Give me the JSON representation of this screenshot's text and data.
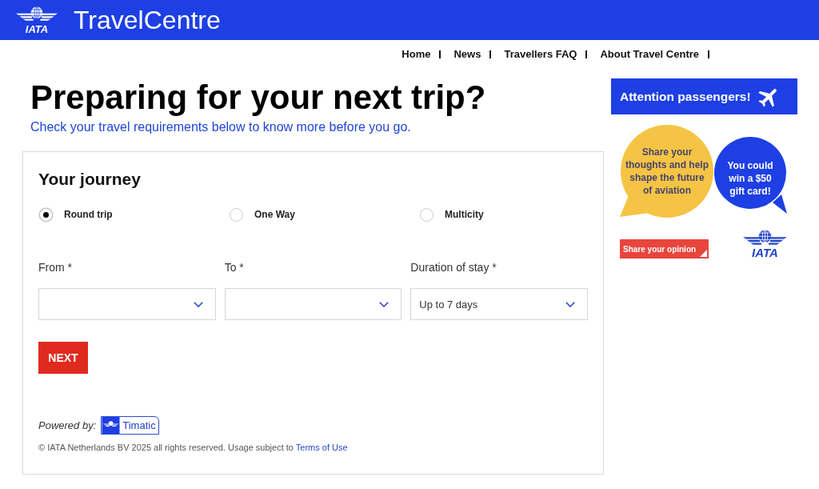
{
  "header": {
    "logo_text": "IATA",
    "title": "TravelCentre"
  },
  "nav": [
    {
      "label": "Home"
    },
    {
      "label": "News"
    },
    {
      "label": "Travellers FAQ"
    },
    {
      "label": "About Travel Centre"
    }
  ],
  "hero": {
    "title": "Preparing for your next trip?",
    "subtitle": "Check your travel requirements below to know more before you go."
  },
  "journey": {
    "title": "Your journey",
    "trip_types": [
      {
        "label": "Round trip",
        "selected": true
      },
      {
        "label": "One Way",
        "selected": false
      },
      {
        "label": "Multicity",
        "selected": false
      }
    ],
    "fields": [
      {
        "label": "From *"
      },
      {
        "label": "To *"
      },
      {
        "label": "Duration of stay *",
        "value": "Up to 7 days"
      }
    ],
    "next_button": "NEXT",
    "powered_by": {
      "label": "Powered by:",
      "badge": "Timatic"
    },
    "copyright": {
      "text": "© IATA Netherlands BV 2025 all rights reserved. Usage subject to",
      "link": "Terms of Use"
    }
  },
  "sidebar": {
    "attention_banner": "Attention passengers!",
    "promo": {
      "bubbles": [
        {
          "text": "Share your\nthoughts and help\nshape the future\nof aviation",
          "color": "#f6c445"
        },
        {
          "text": "You could\nwin a $50\ngift card!",
          "color": "#1d3fe4"
        }
      ],
      "button": "Share your opinion",
      "logo_text": "IATA"
    }
  }
}
